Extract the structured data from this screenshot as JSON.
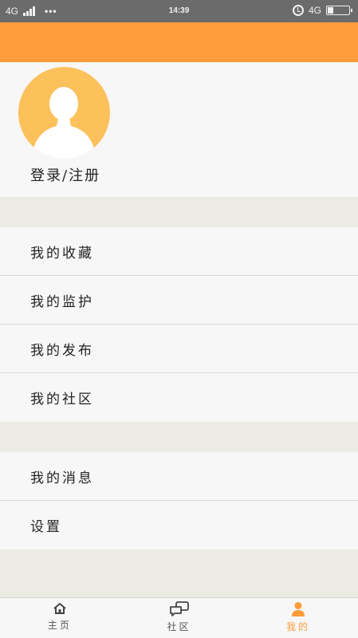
{
  "status_bar": {
    "left_network": "4G",
    "dots": "•••",
    "time": "14:39",
    "right_network": "4G",
    "icons": [
      "signal-icon",
      "alarm-icon",
      "battery-icon"
    ]
  },
  "colors": {
    "accent": "#fe9b3a",
    "avatar": "#fcc15b",
    "page_bg": "#ecebe3",
    "card_bg": "#f7f7f7"
  },
  "profile": {
    "avatar_icon": "user-avatar-icon",
    "login_label": "登录/注册"
  },
  "menu": {
    "group1": [
      {
        "label": "我的收藏"
      },
      {
        "label": "我的监护"
      },
      {
        "label": "我的发布"
      },
      {
        "label": "我的社区"
      }
    ],
    "group2": [
      {
        "label": "我的消息"
      },
      {
        "label": "设置"
      }
    ]
  },
  "tabs": [
    {
      "label": "主页",
      "icon": "home-icon"
    },
    {
      "label": "社区",
      "icon": "chat-bubbles-icon"
    },
    {
      "label": "我的",
      "icon": "person-icon",
      "active": true
    }
  ]
}
